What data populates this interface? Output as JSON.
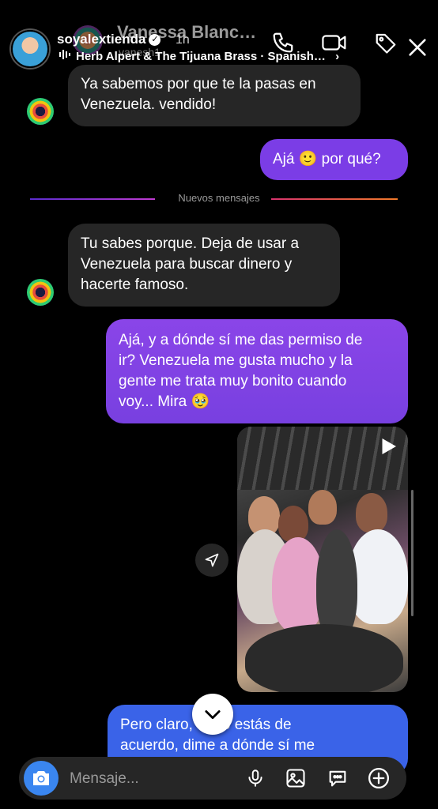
{
  "story": {
    "username": "soyalextienda",
    "time": "1h",
    "music": "Herb Alpert & The Tijuana Brass · Spanish…",
    "music_chevron": "›"
  },
  "chat": {
    "contact_name": "Vanessa Blanc…",
    "contact_sub": "vanesh1",
    "divider_label": "Nuevos mensajes",
    "messages": [
      {
        "from": "them",
        "lines": [
          "Ya sabemos por que te la pasas en",
          "Venezuela. vendido!"
        ]
      },
      {
        "from": "me",
        "lines": [
          "Ajá 🙂 por qué?"
        ]
      },
      {
        "from": "them",
        "lines": [
          "Tu sabes porque. Deja de usar a",
          "Venezuela para buscar dinero y",
          "hacerte famoso."
        ]
      },
      {
        "from": "me",
        "lines": [
          "Ajá, y a dónde sí me das permiso de",
          "ir? Venezuela me gusta mucho y la",
          "gente me trata muy bonito cuando",
          "voy... Mira 🥹"
        ]
      },
      {
        "from": "me",
        "lines": [
          "Pero claro, tú no estás de",
          "acuerdo, dime a dónde sí me"
        ]
      }
    ]
  },
  "composer": {
    "placeholder": "Mensaje..."
  },
  "icons": {
    "header": [
      "phone-icon",
      "video-call-icon",
      "tag-icon",
      "close-icon"
    ],
    "composer": [
      "camera-icon",
      "microphone-icon",
      "gallery-icon",
      "sticker-icon",
      "plus-icon"
    ]
  },
  "colors": {
    "sent_purple": "#7b3de6",
    "sent_blue": "#3a63e8",
    "received": "#262626",
    "camera_button": "#3a86f0"
  }
}
